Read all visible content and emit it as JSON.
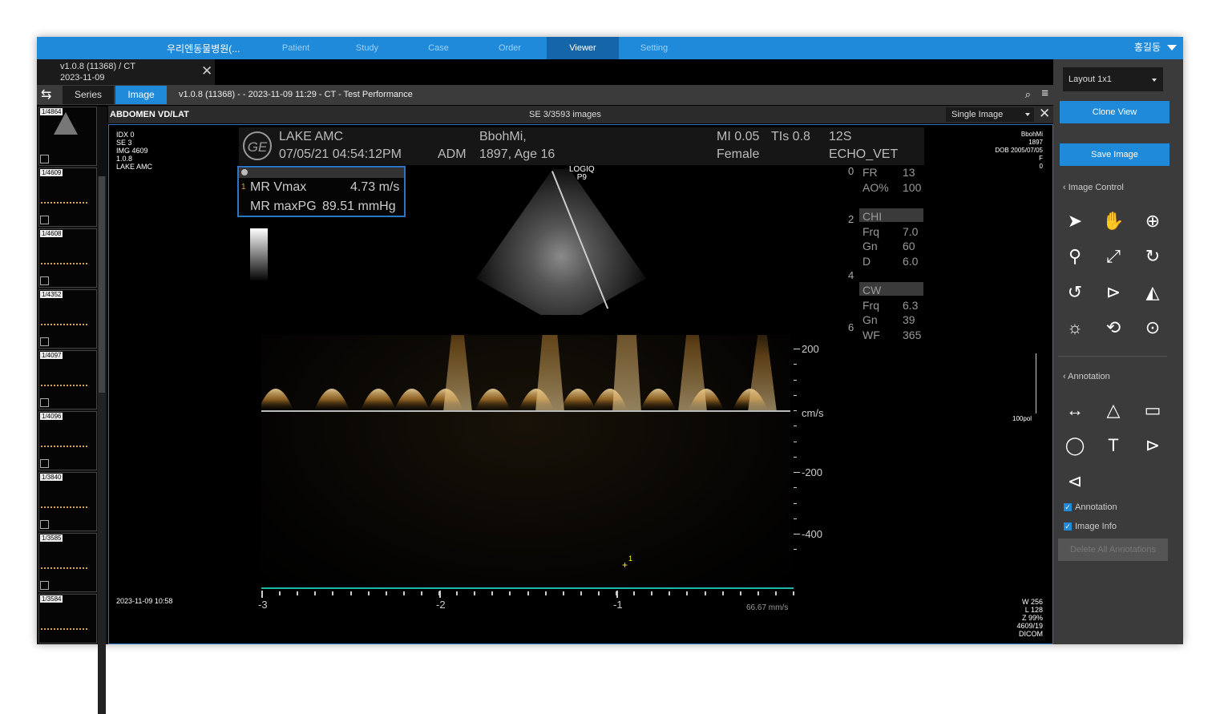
{
  "topbar": {
    "hospital": "우리엔동물병원(...",
    "tabs": [
      "Patient",
      "Study",
      "Case",
      "Order",
      "Viewer",
      "Setting"
    ],
    "active_tab": "Viewer",
    "user": "홍길동"
  },
  "study": {
    "line1": "v1.0.8 (11368) / CT",
    "line2": "2023-11-09"
  },
  "toolbar": {
    "series": "Series",
    "image": "Image",
    "info": "v1.0.8 (11368) -  - 2023-11-09 11:29 - CT - Test Performance"
  },
  "thumbnails": [
    "1/4864",
    "1/4609",
    "1/4608",
    "1/4352",
    "1/4097",
    "1/4096",
    "1/3840",
    "1/3585",
    "1/3584"
  ],
  "viewer": {
    "title": "ABDOMEN VD/LAT",
    "count": "SE 3/3593 images",
    "mode": "Single Image",
    "top_left": [
      "IDX 0",
      "SE 3",
      "IMG 4609",
      "1.0.8",
      "LAKE AMC"
    ],
    "top_right": [
      "BbohMi",
      "1897",
      "DOB 2005/07/05",
      "F",
      "0"
    ],
    "bottom_left": "2023-11-09 10:58",
    "bottom_right": [
      "W 256",
      "L 128",
      "Z 99%",
      "4609/19",
      "DICOM"
    ]
  },
  "us": {
    "ge": "GE",
    "clinic": "LAKE AMC",
    "datetime": "07/05/21 04:54:12PM",
    "adm": "ADM",
    "patient": "BbohMi,",
    "patient2": "1897, Age 16",
    "mi": "MI 0.05",
    "tis": "TIs 0.8",
    "sex": "Female",
    "probe": "12S",
    "preset": "ECHO_VET",
    "logiq1": "LOGIQ",
    "logiq2": "P9",
    "params": [
      {
        "k": "FR",
        "v": "13"
      },
      {
        "k": "AO%",
        "v": "100"
      },
      {
        "k": "CHI",
        "v": ""
      },
      {
        "k": "Frq",
        "v": "7.0"
      },
      {
        "k": "Gn",
        "v": "60"
      },
      {
        "k": "D",
        "v": "6.0"
      },
      {
        "k": "CW",
        "v": ""
      },
      {
        "k": "Frq",
        "v": "6.3"
      },
      {
        "k": "Gn",
        "v": "39"
      },
      {
        "k": "WF",
        "v": "365"
      }
    ],
    "depths": [
      "0",
      "2",
      "4",
      "6"
    ],
    "meas": {
      "idx": "1",
      "l1": "MR Vmax",
      "v1": "4.73 m/s",
      "l2": "MR maxPG",
      "v2": "89.51 mmHg"
    },
    "scale": [
      "200",
      "cm/s",
      "-200",
      "-400"
    ],
    "time": [
      "-3",
      "-2",
      "-1"
    ],
    "speed": "66.67 mm/s",
    "right_scale": "100pol",
    "cursor_label": "1"
  },
  "panel": {
    "layout": "Layout 1x1",
    "clone": "Clone View",
    "save": "Save Image",
    "image_control": "Image Control",
    "annotation_title": "Annotation",
    "cb_annotation": "Annotation",
    "cb_image_info": "Image Info",
    "delete_all": "Delete All Annotations"
  }
}
